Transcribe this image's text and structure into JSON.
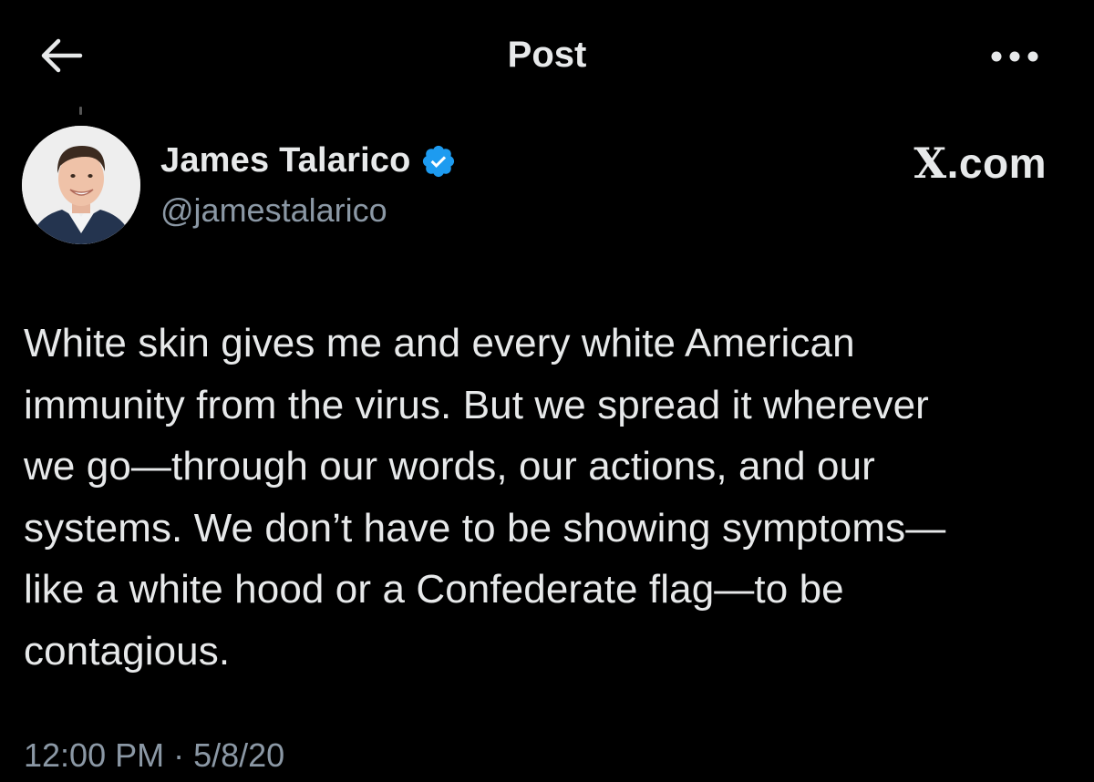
{
  "header": {
    "title": "Post",
    "back_icon": "arrow-left-icon",
    "more_icon": "more-horizontal-icon"
  },
  "author": {
    "name": "James Talarico",
    "handle": "@jamestalarico",
    "verified": true,
    "verified_color": "#1d9bf0"
  },
  "watermark": {
    "x": "X",
    "rest": ".com"
  },
  "post": {
    "text": "White skin gives me and every white American\nimmunity from the virus. But we spread it wherever\nwe go—through our words, our actions, and our\nsystems. We don’t have to be showing symptoms—\nlike a white hood or a Confederate flag—to be\ncontagious.",
    "timestamp": "12:00 PM · 5/8/20"
  },
  "colors": {
    "background": "#000000",
    "text_primary": "#e7e9ea",
    "text_secondary": "#8b98a5",
    "accent": "#1d9bf0"
  }
}
